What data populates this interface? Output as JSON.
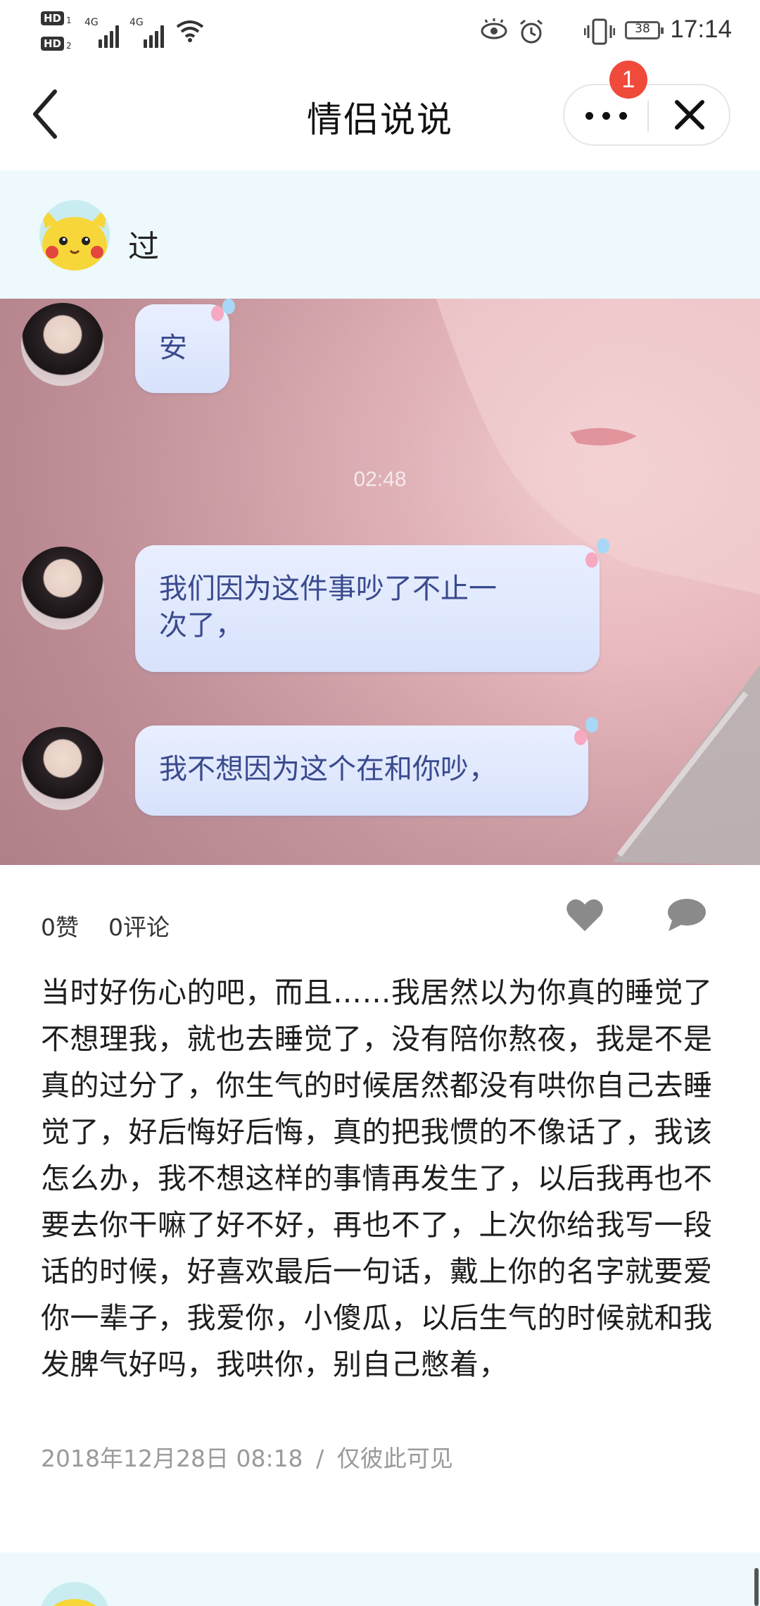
{
  "status_bar": {
    "sim1": "HD",
    "sim1_num": "1",
    "sim2": "HD",
    "sim2_num": "2",
    "network1": "4G",
    "network2": "4G",
    "battery": "38",
    "time": "17:14"
  },
  "header": {
    "title": "情侣说说",
    "badge_count": "1"
  },
  "post": {
    "author": "过",
    "chat_screenshot": {
      "msg1": "安",
      "time": "02:48",
      "msg2_line1": "我们因为这件事吵了不止一",
      "msg2_line2": "次了，",
      "msg3": "我不想因为这个在和你吵，"
    },
    "likes_label": "0赞",
    "comments_label": "0评论",
    "body": "当时好伤心的吧，而且……我居然以为你真的睡觉了不想理我，就也去睡觉了，没有陪你熬夜，我是不是真的过分了，你生气的时候居然都没有哄你自己去睡觉了，好后悔好后悔，真的把我惯的不像话了，我该怎么办，我不想这样的事情再发生了，以后我再也不要去你干嘛了好不好，再也不了，上次你给我写一段话的时候，好喜欢最后一句话，戴上你的名字就要爱你一辈子，我爱你，小傻瓜，以后生气的时候就和我发脾气好吗，我哄你，别自己憋着，",
    "date": "2018年12月28日 08:18",
    "separator": "/",
    "visibility": "仅彼此可见"
  },
  "icons": {
    "back": "chevron-left-icon",
    "more": "more-dots-icon",
    "close": "close-icon",
    "like": "heart-icon",
    "comment": "comment-bubble-icon"
  },
  "colors": {
    "author_bar_bg": "#edf9fc",
    "badge": "#f04a3b",
    "meta_text": "#9a9a9a"
  }
}
